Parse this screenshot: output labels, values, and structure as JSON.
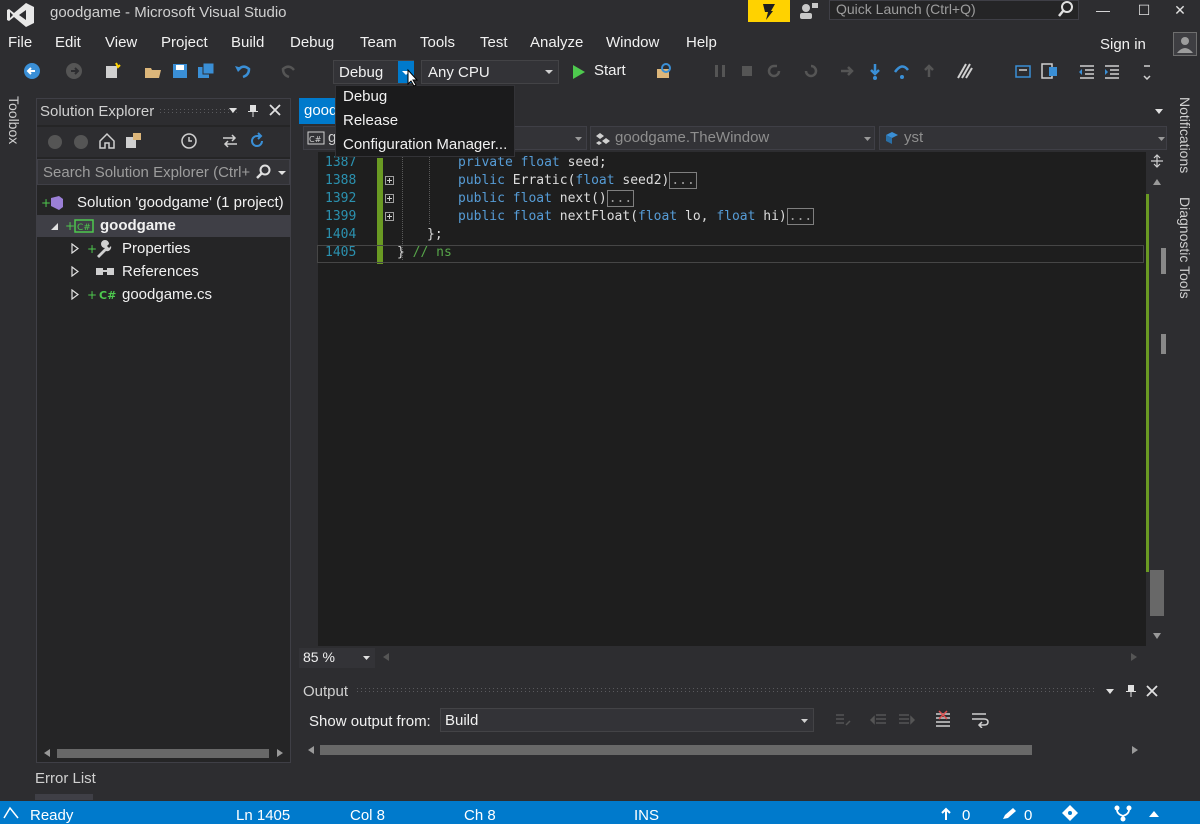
{
  "window": {
    "title": "goodgame - Microsoft Visual Studio"
  },
  "quick_launch": {
    "placeholder": "Quick Launch (Ctrl+Q)"
  },
  "window_controls": {
    "minimize": "—",
    "maximize": "☐",
    "close": "✕"
  },
  "menu": [
    "File",
    "Edit",
    "View",
    "Project",
    "Build",
    "Debug",
    "Team",
    "Tools",
    "Test",
    "Analyze",
    "Window",
    "Help"
  ],
  "account": {
    "sign_in": "Sign in"
  },
  "toolbar": {
    "configuration": "Debug",
    "platform": "Any CPU",
    "start_label": "Start"
  },
  "config_dropdown": {
    "options": [
      "Debug",
      "Release",
      "Configuration Manager..."
    ]
  },
  "side_tabs": {
    "toolbox": "Toolbox",
    "notifications": "Notifications",
    "diagnostic_tools": "Diagnostic Tools"
  },
  "solution_explorer": {
    "title": "Solution Explorer",
    "search_placeholder": "Search Solution Explorer (Ctrl+",
    "tree": {
      "solution": "Solution 'goodgame' (1 project)",
      "project": "goodgame",
      "items": [
        "Properties",
        "References",
        "goodgame.cs"
      ]
    }
  },
  "editor": {
    "tab": "good",
    "nav": {
      "project": "g",
      "type": "goodgame.TheWindow",
      "member": "yst"
    },
    "zoom": "85 %",
    "lines": [
      {
        "num": "1387",
        "indent": "        ",
        "kw1": "private",
        "kw2": "float",
        "text": " seed;",
        "collapsed": ""
      },
      {
        "num": "1388",
        "indent": "        ",
        "kw1": "public",
        "kw2": "",
        "text": " Erratic(",
        "kw3": "float",
        "text2": " seed2)",
        "collapsed": "..."
      },
      {
        "num": "1392",
        "indent": "        ",
        "kw1": "public",
        "kw2": "float",
        "text": " next()",
        "collapsed": "..."
      },
      {
        "num": "1399",
        "indent": "        ",
        "kw1": "public",
        "kw2": "float",
        "text": " nextFloat(",
        "kw3": "float",
        "text2": " lo, ",
        "kw4": "float",
        "text3": " hi)",
        "collapsed": "..."
      },
      {
        "num": "1404",
        "indent": "    ",
        "text": "};"
      },
      {
        "num": "1405",
        "indent": "",
        "text": "} ",
        "comment": "// ns"
      }
    ]
  },
  "output": {
    "title": "Output",
    "show_from_label": "Show output from:",
    "source": "Build"
  },
  "error_list": {
    "label": "Error List"
  },
  "status": {
    "state": "Ready",
    "line": "Ln 1405",
    "col": "Col 8",
    "ch": "Ch 8",
    "mode": "INS",
    "pushes": "0",
    "edits": "0"
  },
  "colors": {
    "accent": "#007acc",
    "background": "#2d2d30",
    "editor_bg": "#1e1e1e",
    "keyword": "#569cd6",
    "comment": "#57a64a",
    "line_number": "#2b91af"
  }
}
